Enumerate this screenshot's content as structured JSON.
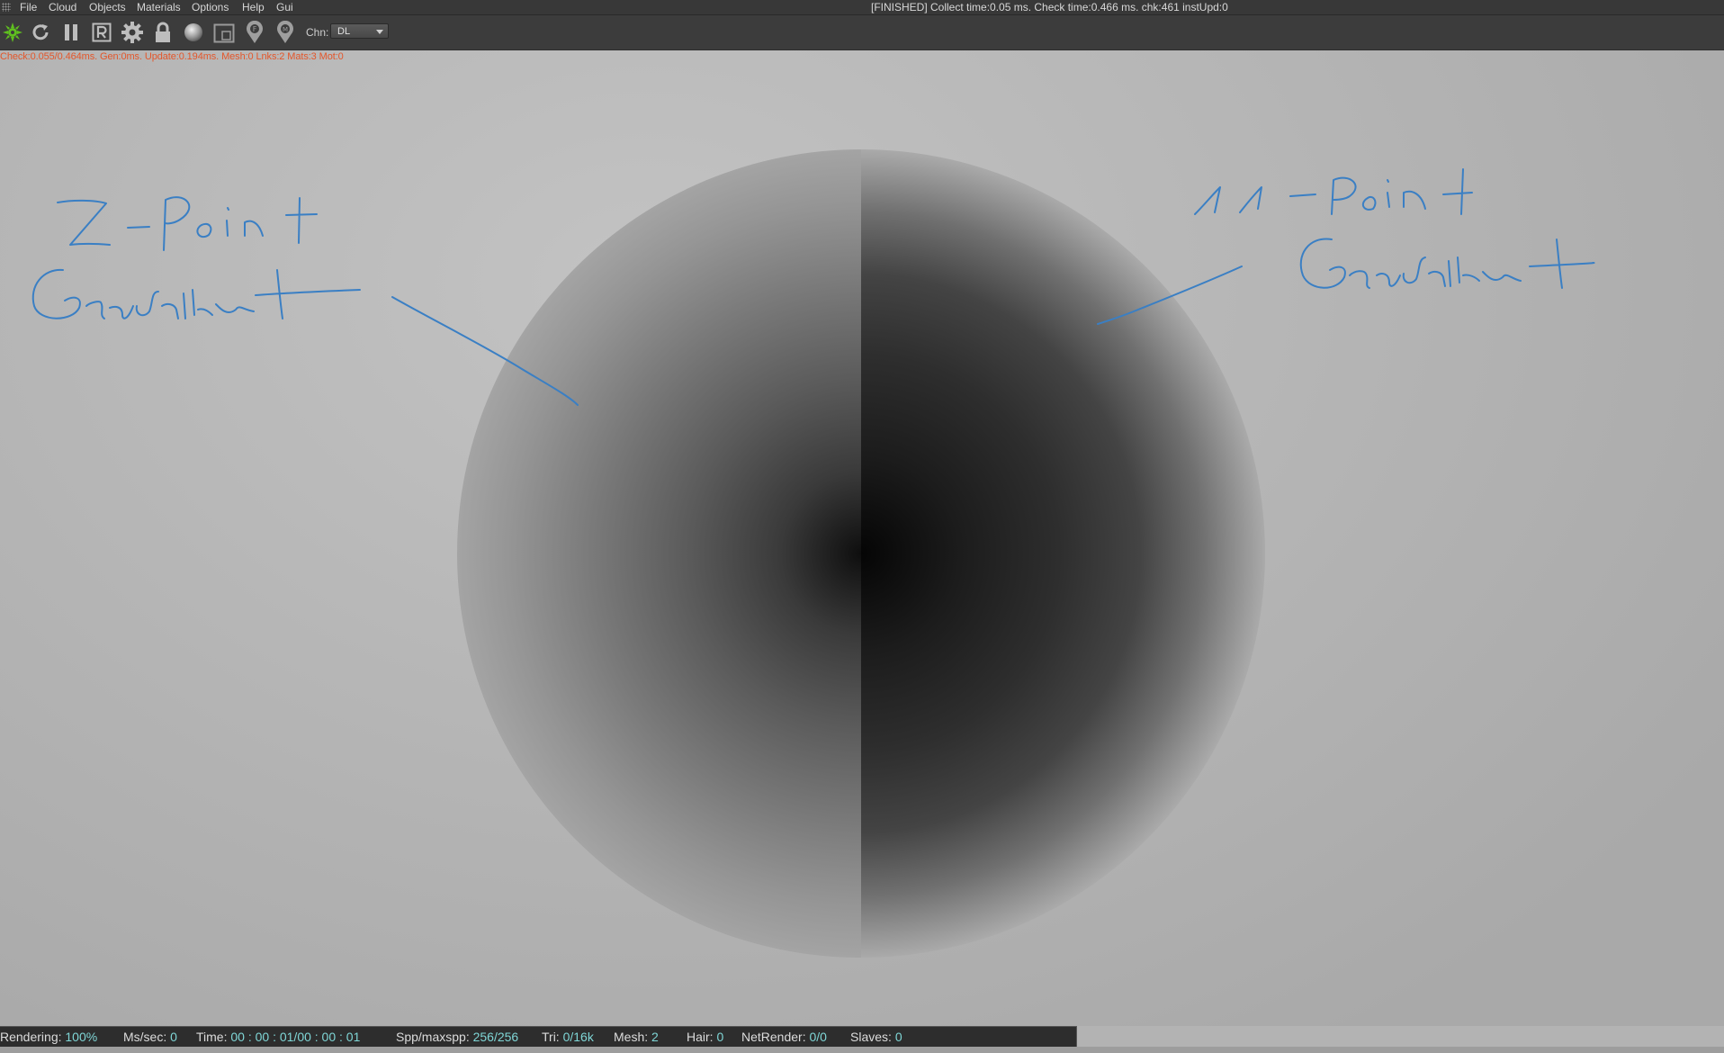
{
  "menubar": {
    "items": [
      "File",
      "Cloud",
      "Objects",
      "Materials",
      "Options",
      "Help",
      "Gui"
    ],
    "status": "[FINISHED] Collect time:0.05 ms.  Check time:0.466 ms.  chk:461  instUpd:0"
  },
  "toolbar": {
    "icons": [
      "octane-logo-icon",
      "refresh-icon",
      "pause-icon",
      "r-icon",
      "gear-icon",
      "lock-icon",
      "sphere-icon",
      "region-icon",
      "pin-f-icon",
      "pin-m-icon"
    ],
    "channel_label": "Chn:",
    "channel_value": "DL"
  },
  "viewport": {
    "stats": "Check:0.055/0.464ms. Gen:0ms. Update:0.194ms. Mesh:0 Lnks:2 Mats:3 Mot:0",
    "annotation_left": "2-Point Gradient",
    "annotation_right": "11-Point Gradient",
    "annotation_color": "#3a7fc4"
  },
  "statusbar": {
    "rendering_label": "Rendering:",
    "rendering_value": "100%",
    "mssec_label": "Ms/sec:",
    "mssec_value": "0",
    "time_label": "Time:",
    "time_value": "00 : 00 : 01/00 : 00 : 01",
    "spp_label": "Spp/maxspp:",
    "spp_value": "256/256",
    "tri_label": "Tri:",
    "tri_value": "0/16k",
    "mesh_label": "Mesh:",
    "mesh_value": "2",
    "hair_label": "Hair:",
    "hair_value": "0",
    "netrender_label": "NetRender:",
    "netrender_value": "0/0",
    "slaves_label": "Slaves:",
    "slaves_value": "0",
    "value_color": "#7fd6d6"
  }
}
